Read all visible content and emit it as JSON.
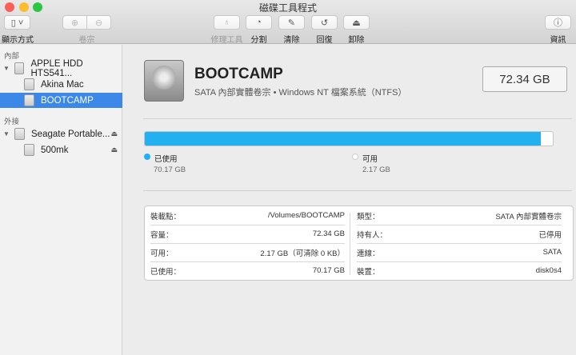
{
  "window": {
    "title": "磁碟工具程式"
  },
  "toolbar": {
    "view": "顯示方式",
    "volume": "卷宗",
    "first_aid": "修理工具",
    "partition": "分割",
    "erase": "清除",
    "restore": "回復",
    "unmount": "卸除",
    "info": "資訊"
  },
  "sidebar": {
    "internal_label": "內部",
    "external_label": "外接",
    "items": [
      {
        "label": "APPLE HDD HTS541..."
      },
      {
        "label": "Akina Mac"
      },
      {
        "label": "BOOTCAMP"
      },
      {
        "label": "Seagate Portable..."
      },
      {
        "label": "500mk"
      }
    ]
  },
  "volume": {
    "name": "BOOTCAMP",
    "subtitle": "SATA 內部實體卷宗 • Windows NT 檔案系統（NTFS）",
    "capacity": "72.34 GB",
    "usage": {
      "used_fraction": 0.97,
      "used_label": "已使用",
      "used_value": "70.17 GB",
      "free_label": "可用",
      "free_value": "2.17 GB",
      "used_color": "#22b0f0"
    },
    "details": {
      "left": [
        {
          "k": "裝載點：",
          "v": "/Volumes/BOOTCAMP"
        },
        {
          "k": "容量：",
          "v": "72.34 GB"
        },
        {
          "k": "可用：",
          "v": "2.17 GB（可清除 0 KB）"
        },
        {
          "k": "已使用：",
          "v": "70.17 GB"
        }
      ],
      "right": [
        {
          "k": "類型：",
          "v": "SATA 內部實體卷宗"
        },
        {
          "k": "持有人：",
          "v": "已停用"
        },
        {
          "k": "連線：",
          "v": "SATA"
        },
        {
          "k": "裝置：",
          "v": "disk0s4"
        }
      ]
    }
  }
}
